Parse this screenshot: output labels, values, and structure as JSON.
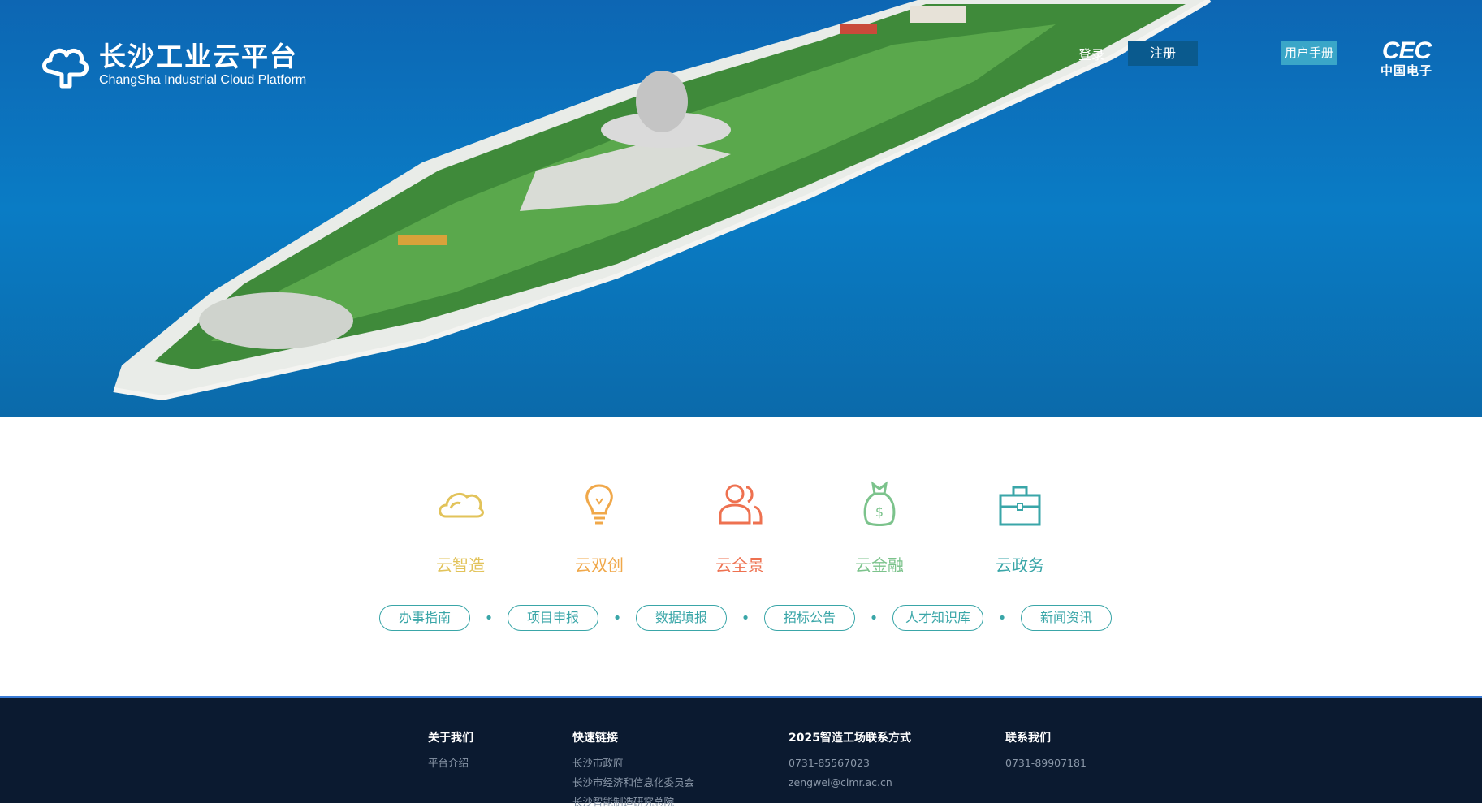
{
  "header": {
    "logo_title": "长沙工业云平台",
    "logo_subtitle": "ChangSha Industrial Cloud Platform",
    "login_label": "登录",
    "register_label": "注册",
    "manual_label": "用户手册",
    "partner_logo_en": "CEC",
    "partner_logo_cn": "中国电子"
  },
  "services": [
    {
      "label": "云智造",
      "icon": "cloud-icon",
      "color": "#e2c35a"
    },
    {
      "label": "云双创",
      "icon": "lightbulb-icon",
      "color": "#f0a84a"
    },
    {
      "label": "云全景",
      "icon": "users-icon",
      "color": "#ee7150"
    },
    {
      "label": "云金融",
      "icon": "money-bag-icon",
      "color": "#7cc38c"
    },
    {
      "label": "云政务",
      "icon": "briefcase-icon",
      "color": "#3aa6a8"
    }
  ],
  "quick_links": [
    "办事指南",
    "项目申报",
    "数据填报",
    "招标公告",
    "人才知识库",
    "新闻资讯"
  ],
  "footer": {
    "about": {
      "heading": "关于我们",
      "items": [
        "平台介绍"
      ]
    },
    "links": {
      "heading": "快速链接",
      "items": [
        "长沙市政府",
        "长沙市经济和信息化委员会",
        "长沙智能制造研究总院"
      ]
    },
    "contact2025": {
      "heading": "2025智造工场联系方式",
      "items": [
        "0731-85567023",
        "zengwei@cimr.ac.cn"
      ]
    },
    "contact": {
      "heading": "联系我们",
      "items": [
        "0731-89907181"
      ]
    }
  },
  "colors": {
    "accent": "#3aa6a8",
    "footer_bg": "#0b1a30",
    "footer_border": "#3a7bd5"
  }
}
